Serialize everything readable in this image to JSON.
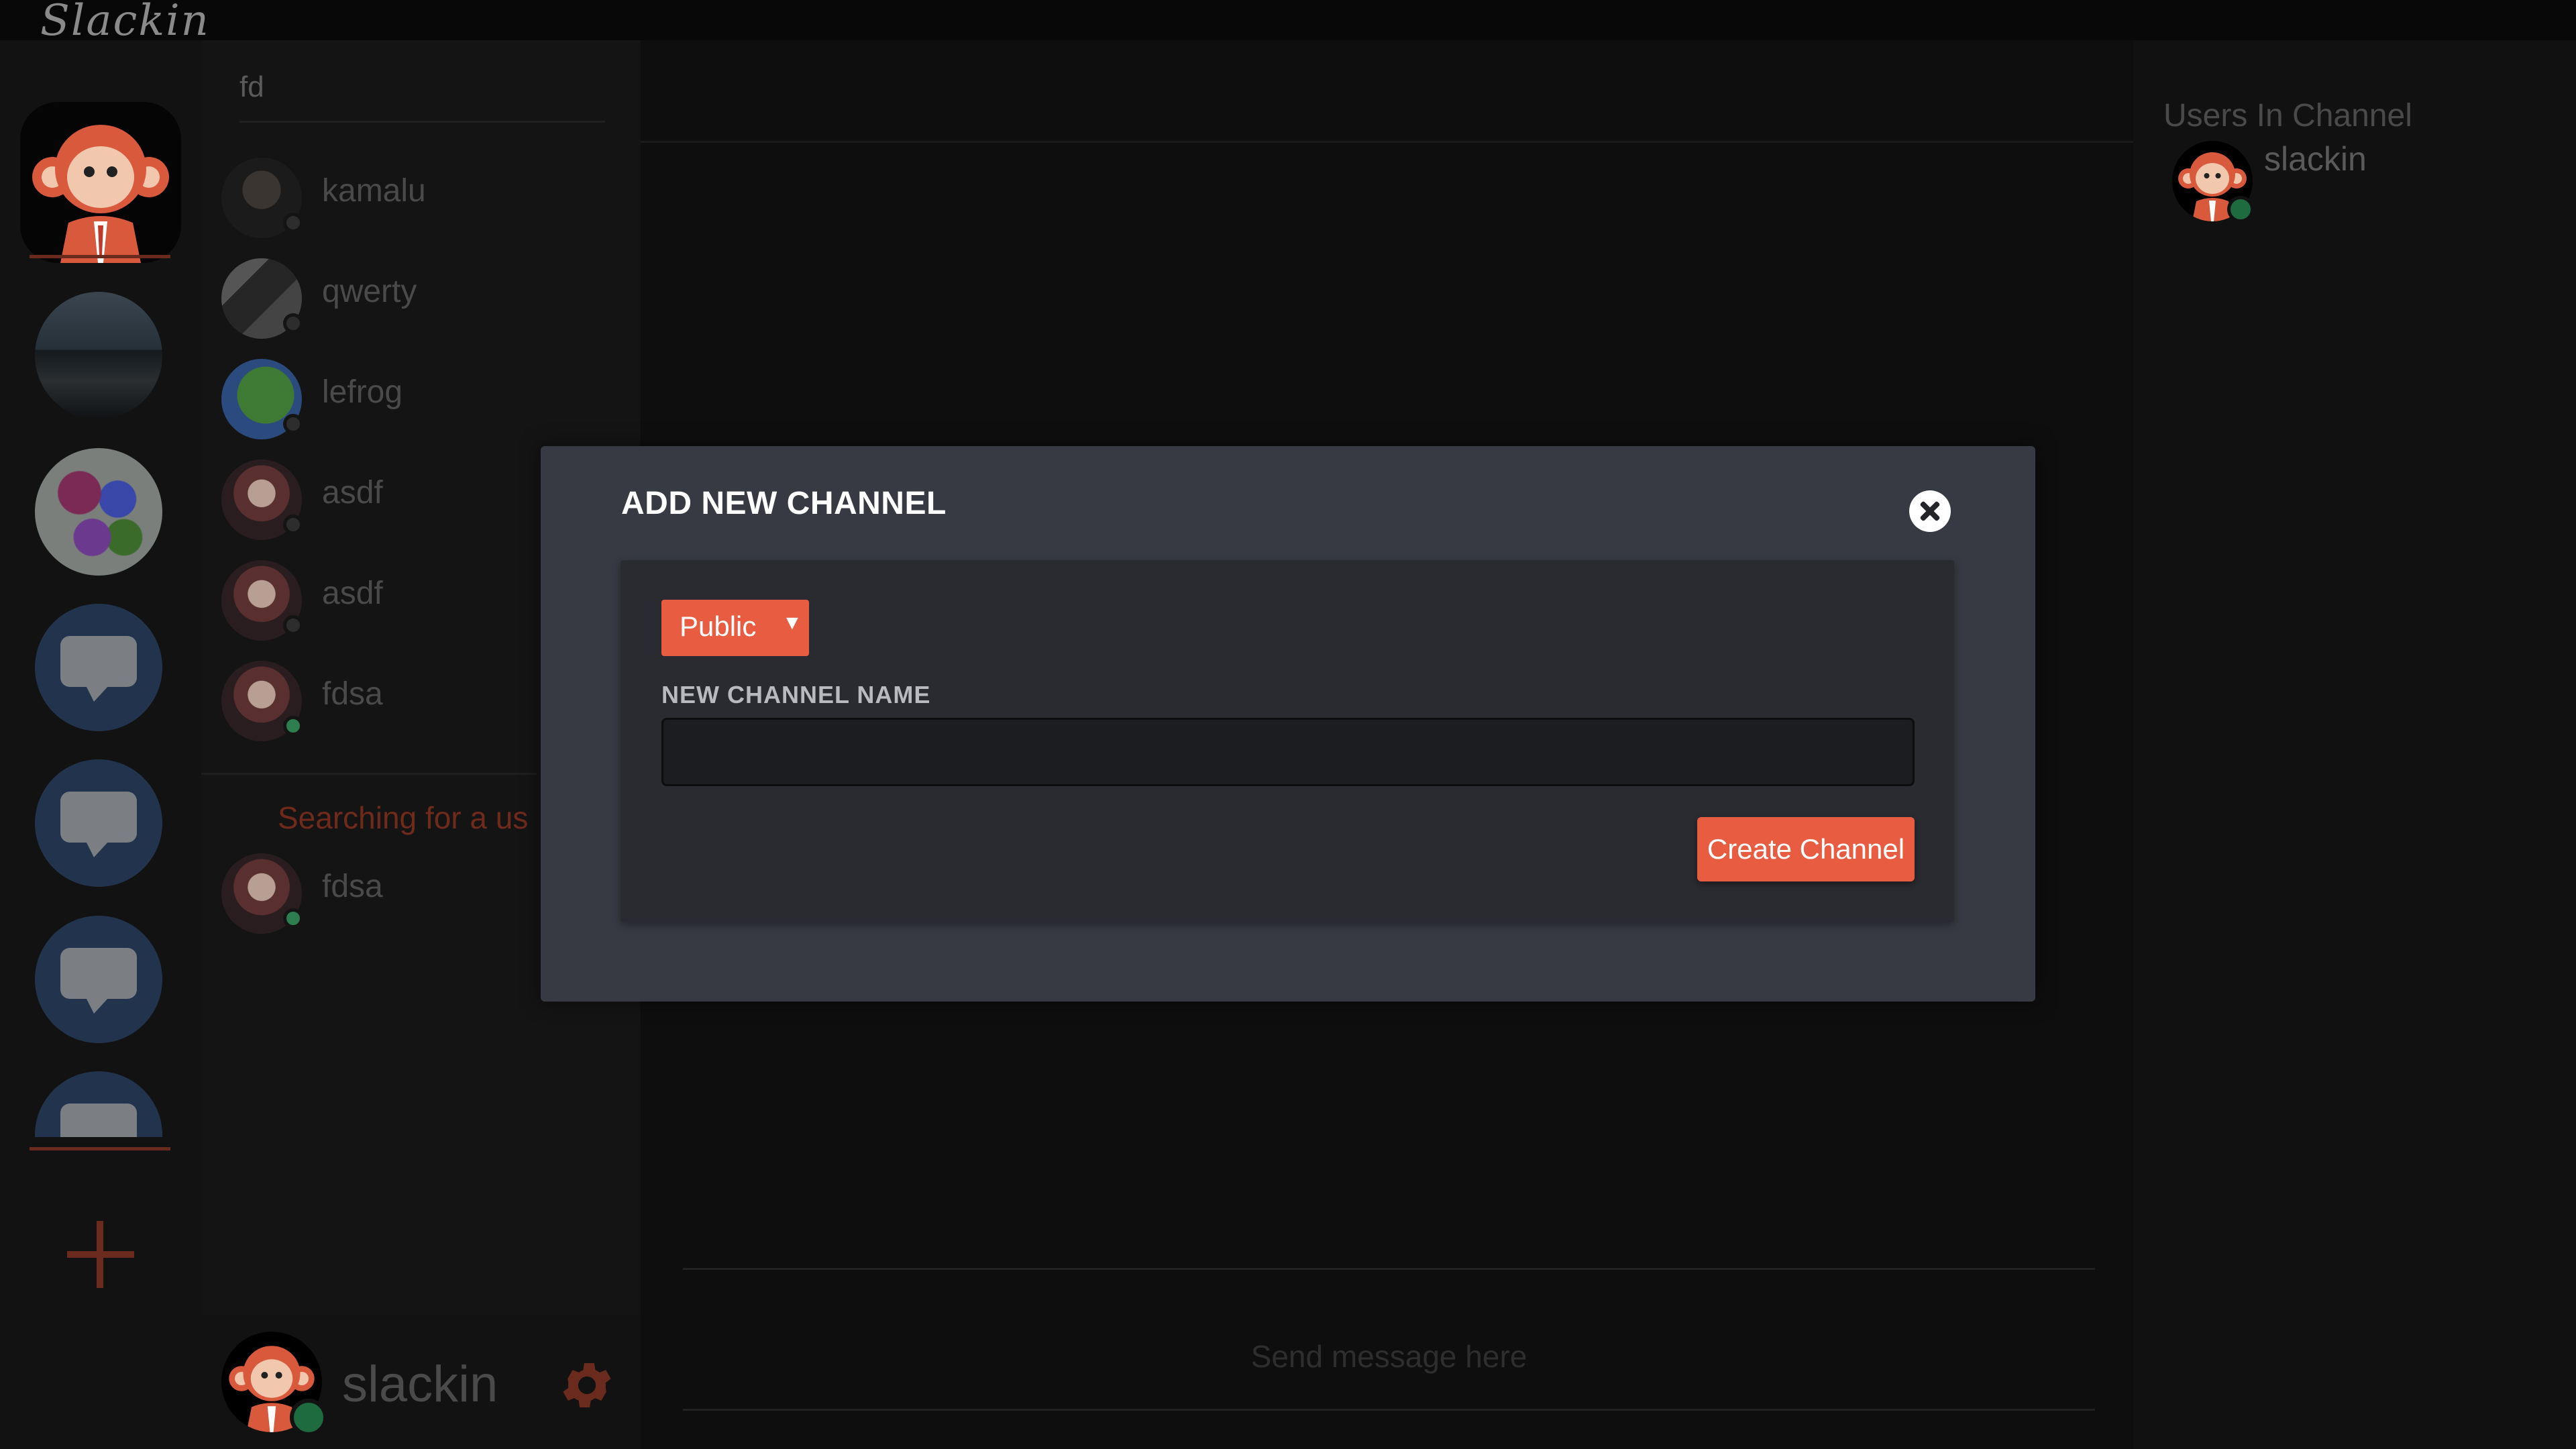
{
  "app": {
    "logo_text": "Slackin"
  },
  "contacts": {
    "search_value": "fd",
    "users": [
      {
        "name": "kamalu",
        "status": "offline"
      },
      {
        "name": "qwerty",
        "status": "offline"
      },
      {
        "name": "lefrog",
        "status": "offline"
      },
      {
        "name": "asdf",
        "status": "offline"
      },
      {
        "name": "asdf",
        "status": "offline"
      },
      {
        "name": "fdsa",
        "status": "online"
      }
    ],
    "search_notice": "Searching for a us",
    "search_results": [
      {
        "name": "fdsa",
        "status": "online"
      }
    ]
  },
  "current_user": {
    "name": "slackin",
    "status": "online"
  },
  "main": {
    "composer_placeholder": "Send message here"
  },
  "right_panel": {
    "title": "Users In Channel",
    "users": [
      {
        "name": "slackin",
        "status": "online"
      }
    ]
  },
  "modal": {
    "title": "ADD NEW CHANNEL",
    "visibility_selected": "Public",
    "name_label": "NEW CHANNEL NAME",
    "name_value": "",
    "create_button": "Create Channel"
  },
  "colors": {
    "accent": "#e85d42",
    "online": "#2e7d4e",
    "modal_bg": "#373a42"
  }
}
